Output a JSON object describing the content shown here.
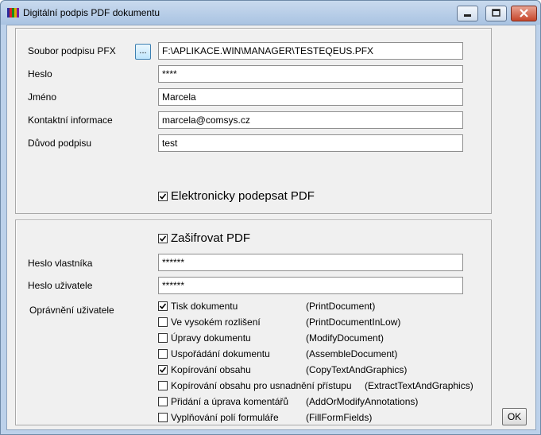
{
  "window": {
    "title": "Digitální podpis PDF dokumentu"
  },
  "signature": {
    "pfx_label": "Soubor podpisu PFX",
    "browse_label": "...",
    "pfx_value": "F:\\APLIKACE.WIN\\MANAGER\\TESTEQEUS.PFX",
    "password_label": "Heslo",
    "password_value": "****",
    "name_label": "Jméno",
    "name_value": "Marcela",
    "contact_label": "Kontaktní informace",
    "contact_value": "marcela@comsys.cz",
    "reason_label": "Důvod podpisu",
    "reason_value": "test",
    "sign_checkbox_label": "Elektronicky podepsat PDF",
    "sign_checked": true
  },
  "encryption": {
    "encrypt_checkbox_label": "Zašifrovat PDF",
    "encrypt_checked": true,
    "owner_password_label": "Heslo vlastníka",
    "owner_password_value": "******",
    "user_password_label": "Heslo uživatele",
    "user_password_value": "******",
    "permissions_label": "Oprávnění uživatele",
    "permissions": [
      {
        "label": "Tisk dokumentu",
        "api": "(PrintDocument)",
        "checked": true
      },
      {
        "label": "Ve vysokém rozlišení",
        "api": "(PrintDocumentInLow)",
        "checked": false
      },
      {
        "label": "Úpravy dokumentu",
        "api": "(ModifyDocument)",
        "checked": false
      },
      {
        "label": "Uspořádání dokumentu",
        "api": "(AssembleDocument)",
        "checked": false
      },
      {
        "label": "Kopírování obsahu",
        "api": "(CopyTextAndGraphics)",
        "checked": true
      },
      {
        "label": "Kopírování obsahu pro usnadnění přístupu",
        "api": "(ExtractTextAndGraphics)",
        "checked": false
      },
      {
        "label": "Přidání a úprava komentářů",
        "api": "(AddOrModifyAnnotations)",
        "checked": false
      },
      {
        "label": "Vyplňování polí formuláře",
        "api": "(FillFormFields)",
        "checked": false
      }
    ]
  },
  "ok_label": "OK"
}
